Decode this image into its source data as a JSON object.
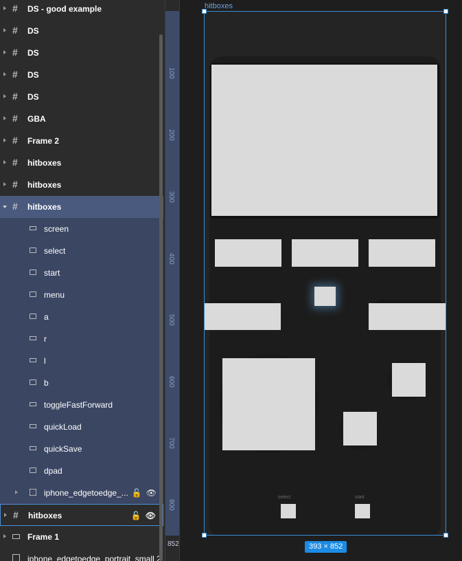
{
  "layers": {
    "top_rows": [
      {
        "label": "DS - good example"
      },
      {
        "label": "DS"
      },
      {
        "label": "DS"
      },
      {
        "label": "DS"
      },
      {
        "label": "DS"
      },
      {
        "label": "GBA"
      },
      {
        "label": "Frame 2"
      },
      {
        "label": "hitboxes"
      },
      {
        "label": "hitboxes"
      }
    ],
    "selected": {
      "label": "hitboxes"
    },
    "children": [
      {
        "label": "screen",
        "icon": "rectangle-icon"
      },
      {
        "label": "select",
        "icon": "rectangle-icon"
      },
      {
        "label": "start",
        "icon": "rectangle-icon"
      },
      {
        "label": "menu",
        "icon": "rectangle-icon"
      },
      {
        "label": "a",
        "icon": "rectangle-icon"
      },
      {
        "label": "r",
        "icon": "rectangle-icon"
      },
      {
        "label": "l",
        "icon": "rectangle-icon"
      },
      {
        "label": "b",
        "icon": "rectangle-icon"
      },
      {
        "label": "toggleFastForward",
        "icon": "rectangle-icon"
      },
      {
        "label": "quickLoad",
        "icon": "rectangle-icon"
      },
      {
        "label": "quickSave",
        "icon": "rectangle-icon"
      },
      {
        "label": "dpad",
        "icon": "rectangle-icon"
      },
      {
        "label": "iphone_edgetoedge_...",
        "icon": "image-icon"
      }
    ],
    "hover_row": {
      "label": "hitboxes"
    },
    "bottom_rows": [
      {
        "label": "Frame 1"
      },
      {
        "label": "iphone_edgetoedge_portrait_small 2"
      }
    ]
  },
  "ruler": {
    "ticks": [
      "100",
      "200",
      "300",
      "400",
      "500",
      "600",
      "700",
      "800"
    ],
    "end_label": "852"
  },
  "canvas": {
    "frame_title": "hitboxes",
    "size_badge": "393 × 852",
    "select_label": "select",
    "start_label": "start"
  },
  "colors": {
    "selection": "#3a8fd8",
    "badge": "#1c8be4",
    "hitbox": "#dadada"
  }
}
